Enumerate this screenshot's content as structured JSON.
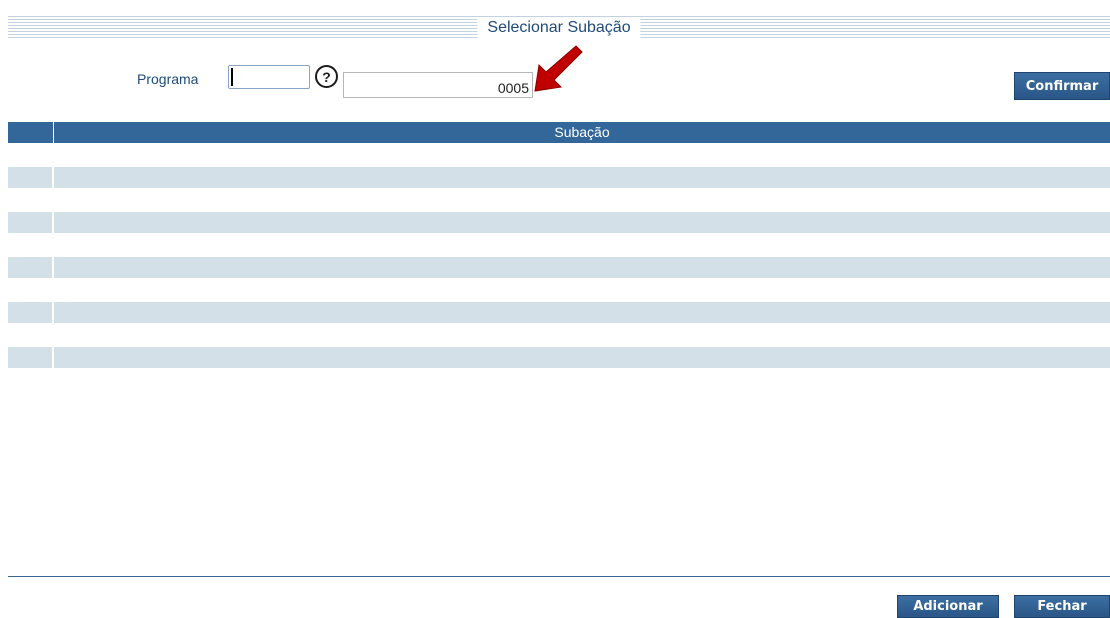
{
  "dialog": {
    "title": "Selecionar Subação"
  },
  "filter": {
    "label": "Programa",
    "program_code_value": "",
    "help_icon": "question-circle-icon",
    "description_value": "0005",
    "confirm_label": "Confirmar"
  },
  "table": {
    "columns": [
      "",
      "Subação"
    ],
    "rows": [
      {
        "name": ""
      },
      {
        "name": ""
      },
      {
        "name": ""
      },
      {
        "name": ""
      },
      {
        "name": ""
      }
    ]
  },
  "footer": {
    "add_label": "Adicionar",
    "close_label": "Fechar"
  },
  "annotation": {
    "icon": "red-arrow-icon",
    "color": "#c00000"
  },
  "colors": {
    "accent": "#336699",
    "row_bg": "#d3e0e8",
    "title_text": "#1f4a78"
  }
}
